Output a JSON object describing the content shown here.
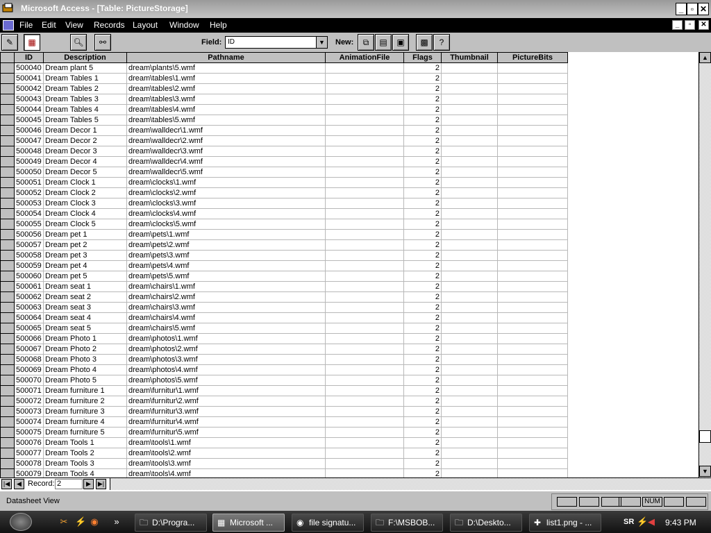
{
  "window": {
    "title": "Microsoft Access - [Table: PictureStorage]"
  },
  "menu": [
    "File",
    "Edit",
    "View",
    "Records",
    "Layout",
    "Window",
    "Help"
  ],
  "toolbar": {
    "field_label": "Field:",
    "field_value": "ID",
    "new_label": "New:"
  },
  "table": {
    "columns": [
      "ID",
      "Description",
      "Pathname",
      "AnimationFile",
      "Flags",
      "Thumbnail",
      "PictureBits"
    ],
    "rows": [
      [
        "500040",
        "Dream plant 5",
        "dream\\plants\\5.wmf",
        "",
        "2",
        "",
        ""
      ],
      [
        "500041",
        "Dream Tables 1",
        "dream\\tables\\1.wmf",
        "",
        "2",
        "",
        ""
      ],
      [
        "500042",
        "Dream Tables 2",
        "dream\\tables\\2.wmf",
        "",
        "2",
        "",
        ""
      ],
      [
        "500043",
        "Dream Tables 3",
        "dream\\tables\\3.wmf",
        "",
        "2",
        "",
        ""
      ],
      [
        "500044",
        "Dream Tables 4",
        "dream\\tables\\4.wmf",
        "",
        "2",
        "",
        ""
      ],
      [
        "500045",
        "Dream Tables 5",
        "dream\\tables\\5.wmf",
        "",
        "2",
        "",
        ""
      ],
      [
        "500046",
        "Dream Decor 1",
        "dream\\walldecr\\1.wmf",
        "",
        "2",
        "",
        ""
      ],
      [
        "500047",
        "Dream Decor 2",
        "dream\\walldecr\\2.wmf",
        "",
        "2",
        "",
        ""
      ],
      [
        "500048",
        "Dream Decor 3",
        "dream\\walldecr\\3.wmf",
        "",
        "2",
        "",
        ""
      ],
      [
        "500049",
        "Dream Decor 4",
        "dream\\walldecr\\4.wmf",
        "",
        "2",
        "",
        ""
      ],
      [
        "500050",
        "Dream Decor 5",
        "dream\\walldecr\\5.wmf",
        "",
        "2",
        "",
        ""
      ],
      [
        "500051",
        "Dream Clock 1",
        "dream\\clocks\\1.wmf",
        "",
        "2",
        "",
        ""
      ],
      [
        "500052",
        "Dream Clock 2",
        "dream\\clocks\\2.wmf",
        "",
        "2",
        "",
        ""
      ],
      [
        "500053",
        "Dream Clock 3",
        "dream\\clocks\\3.wmf",
        "",
        "2",
        "",
        ""
      ],
      [
        "500054",
        "Dream Clock 4",
        "dream\\clocks\\4.wmf",
        "",
        "2",
        "",
        ""
      ],
      [
        "500055",
        "Dream Clock 5",
        "dream\\clocks\\5.wmf",
        "",
        "2",
        "",
        ""
      ],
      [
        "500056",
        "Dream pet 1",
        "dream\\pets\\1.wmf",
        "",
        "2",
        "",
        ""
      ],
      [
        "500057",
        "Dream pet 2",
        "dream\\pets\\2.wmf",
        "",
        "2",
        "",
        ""
      ],
      [
        "500058",
        "Dream pet 3",
        "dream\\pets\\3.wmf",
        "",
        "2",
        "",
        ""
      ],
      [
        "500059",
        "Dream pet 4",
        "dream\\pets\\4.wmf",
        "",
        "2",
        "",
        ""
      ],
      [
        "500060",
        "Dream pet 5",
        "dream\\pets\\5.wmf",
        "",
        "2",
        "",
        ""
      ],
      [
        "500061",
        "Dream seat 1",
        "dream\\chairs\\1.wmf",
        "",
        "2",
        "",
        ""
      ],
      [
        "500062",
        "Dream seat 2",
        "dream\\chairs\\2.wmf",
        "",
        "2",
        "",
        ""
      ],
      [
        "500063",
        "Dream seat 3",
        "dream\\chairs\\3.wmf",
        "",
        "2",
        "",
        ""
      ],
      [
        "500064",
        "Dream seat 4",
        "dream\\chairs\\4.wmf",
        "",
        "2",
        "",
        ""
      ],
      [
        "500065",
        "Dream seat 5",
        "dream\\chairs\\5.wmf",
        "",
        "2",
        "",
        ""
      ],
      [
        "500066",
        "Dream Photo 1",
        "dream\\photos\\1.wmf",
        "",
        "2",
        "",
        ""
      ],
      [
        "500067",
        "Dream Photo 2",
        "dream\\photos\\2.wmf",
        "",
        "2",
        "",
        ""
      ],
      [
        "500068",
        "Dream Photo 3",
        "dream\\photos\\3.wmf",
        "",
        "2",
        "",
        ""
      ],
      [
        "500069",
        "Dream Photo 4",
        "dream\\photos\\4.wmf",
        "",
        "2",
        "",
        ""
      ],
      [
        "500070",
        "Dream Photo 5",
        "dream\\photos\\5.wmf",
        "",
        "2",
        "",
        ""
      ],
      [
        "500071",
        "Dream furniture 1",
        "dream\\furnitur\\1.wmf",
        "",
        "2",
        "",
        ""
      ],
      [
        "500072",
        "Dream furniture 2",
        "dream\\furnitur\\2.wmf",
        "",
        "2",
        "",
        ""
      ],
      [
        "500073",
        "Dream furniture 3",
        "dream\\furnitur\\3.wmf",
        "",
        "2",
        "",
        ""
      ],
      [
        "500074",
        "Dream furniture 4",
        "dream\\furnitur\\4.wmf",
        "",
        "2",
        "",
        ""
      ],
      [
        "500075",
        "Dream furniture 5",
        "dream\\furnitur\\5.wmf",
        "",
        "2",
        "",
        ""
      ],
      [
        "500076",
        "Dream Tools 1",
        "dream\\tools\\1.wmf",
        "",
        "2",
        "",
        ""
      ],
      [
        "500077",
        "Dream Tools 2",
        "dream\\tools\\2.wmf",
        "",
        "2",
        "",
        ""
      ],
      [
        "500078",
        "Dream Tools 3",
        "dream\\tools\\3.wmf",
        "",
        "2",
        "",
        ""
      ],
      [
        "500079",
        "Dream Tools 4",
        "dream\\tools\\4.wmf",
        "",
        "2",
        "",
        ""
      ]
    ]
  },
  "navigation": {
    "record_label": "Record:",
    "record_value": "2"
  },
  "status": {
    "message": "Datasheet View",
    "indicators": [
      "",
      "",
      "",
      "",
      "NUM",
      "",
      ""
    ]
  },
  "taskbar": {
    "tasks": [
      {
        "label": "D:\\Progra...",
        "icon": "folder-icon",
        "active": false
      },
      {
        "label": "Microsoft ...",
        "icon": "access-icon",
        "active": true
      },
      {
        "label": "file signatu...",
        "icon": "firefox-icon",
        "active": false
      },
      {
        "label": "F:\\MSBOB...",
        "icon": "folder-icon",
        "active": false
      },
      {
        "label": "D:\\Deskto...",
        "icon": "folder-icon",
        "active": false
      },
      {
        "label": "list1.png - ...",
        "icon": "paint-icon",
        "active": false
      }
    ],
    "lang": "SR",
    "clock": "9:43 PM"
  }
}
